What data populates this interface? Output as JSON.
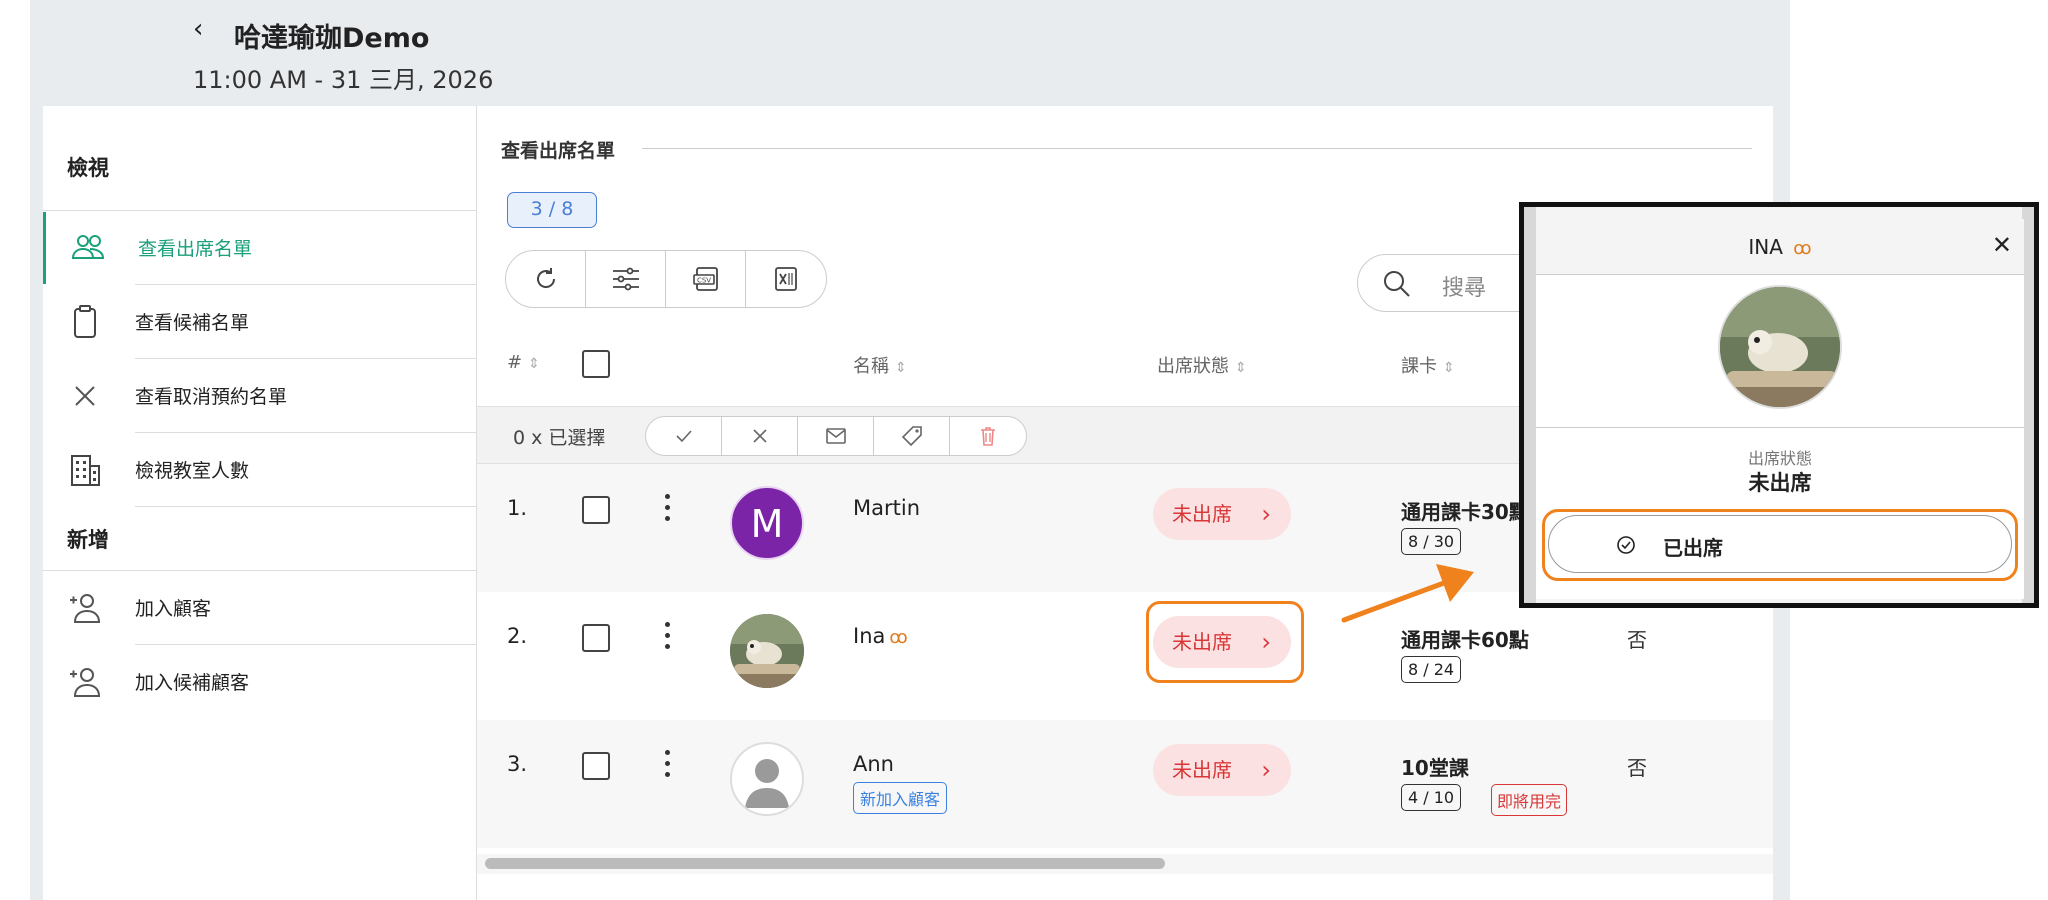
{
  "header": {
    "back_icon": "chevron-left-icon",
    "title": "哈達瑜珈Demo",
    "subtitle": "11:00 AM - 31 三月, 2026"
  },
  "sidebar": {
    "view_heading": "檢視",
    "view_items": [
      {
        "label": "查看出席名單",
        "icon": "users-icon",
        "active": true
      },
      {
        "label": "查看候補名單",
        "icon": "clipboard-icon",
        "active": false
      },
      {
        "label": "查看取消預約名單",
        "icon": "x-icon",
        "active": false
      },
      {
        "label": "檢視教室人數",
        "icon": "building-icon",
        "active": false
      }
    ],
    "add_heading": "新增",
    "add_items": [
      {
        "label": "加入顧客",
        "icon": "add-user-icon"
      },
      {
        "label": "加入候補顧客",
        "icon": "add-user-icon"
      }
    ]
  },
  "main": {
    "section_title": "查看出席名單",
    "count_pill": "3 / 8",
    "toolbar": [
      "refresh-icon",
      "filter-icon",
      "csv-export-icon",
      "excel-export-icon"
    ],
    "search_placeholder": "搜尋",
    "columns": {
      "num": "#",
      "name": "名稱",
      "status": "出席狀態",
      "card": "課卡"
    },
    "bulk": {
      "selected": "0 x 已選擇",
      "actions": [
        "check-icon",
        "x-icon",
        "mail-icon",
        "tag-icon",
        "trash-icon"
      ]
    },
    "rows": [
      {
        "num": "1.",
        "name": "Martin",
        "avatar_letter": "M",
        "status": "未出席",
        "card_name": "通用課卡30點",
        "card_count": "8 / 30",
        "extra": ""
      },
      {
        "num": "2.",
        "name": "Ina",
        "pretzel": "ꝏ",
        "status": "未出席",
        "card_name": "通用課卡60點",
        "card_count": "8 / 24",
        "extra": "否"
      },
      {
        "num": "3.",
        "name": "Ann",
        "tag": "新加入顧客",
        "status": "未出席",
        "card_name": "10堂課",
        "card_count": "4 / 10",
        "card_warn": "即將用完",
        "extra": "否"
      }
    ]
  },
  "modal": {
    "title": "INA",
    "pretzel": "ꝏ",
    "status_label": "出席狀態",
    "status_value": "未出席",
    "action_label": "已出席"
  },
  "colors": {
    "accent": "#1aa07b",
    "status_red": "#d93737",
    "highlight": "#f0821e",
    "link_blue": "#3b82e0"
  }
}
